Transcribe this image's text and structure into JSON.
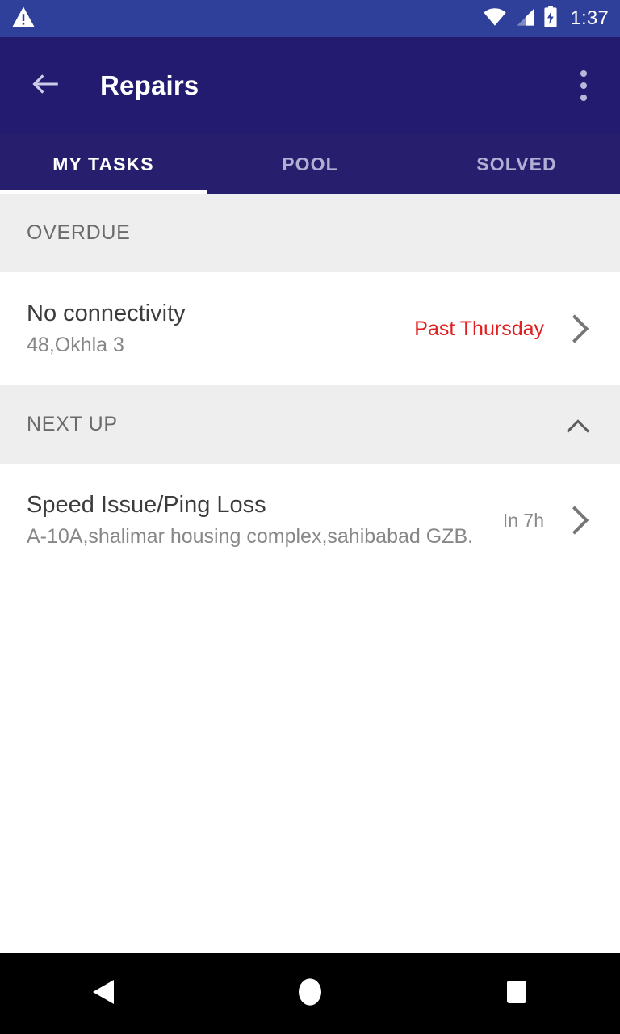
{
  "status_bar": {
    "warning_icon": "warning-triangle-icon",
    "wifi_icon": "wifi-icon",
    "signal_icon": "cellular-signal-icon",
    "battery_icon": "battery-charging-icon",
    "time": "1:37"
  },
  "app_bar": {
    "back_icon": "arrow-back-icon",
    "title": "Repairs",
    "overflow_icon": "overflow-menu-icon"
  },
  "tabs": [
    {
      "label": "MY TASKS",
      "active": true
    },
    {
      "label": "POOL",
      "active": false
    },
    {
      "label": "SOLVED",
      "active": false
    }
  ],
  "sections": [
    {
      "title": "OVERDUE",
      "collapsible": false,
      "tasks": [
        {
          "title": "No connectivity",
          "address": "48,Okhla 3",
          "due": "Past Thursday",
          "due_state": "overdue",
          "chevron": "chevron-right-icon"
        }
      ]
    },
    {
      "title": "NEXT UP",
      "collapsible": true,
      "toggle_icon": "chevron-up-icon",
      "tasks": [
        {
          "title": "Speed Issue/Ping Loss",
          "address": "A-10A,shalimar housing complex,sahibabad GZB.",
          "due": "In 7h",
          "due_state": "upcoming",
          "chevron": "chevron-right-icon"
        }
      ]
    }
  ],
  "nav_bar": {
    "back": "nav-back-icon",
    "home": "nav-home-icon",
    "recents": "nav-recents-icon"
  },
  "colors": {
    "status_bar": "#2e409a",
    "app_bar": "#231b70",
    "tab_bar": "#271f6e",
    "accent_white": "#ffffff",
    "section_bg": "#eeeeee",
    "overdue_red": "#e02020",
    "muted_text": "#8a8a8a"
  }
}
